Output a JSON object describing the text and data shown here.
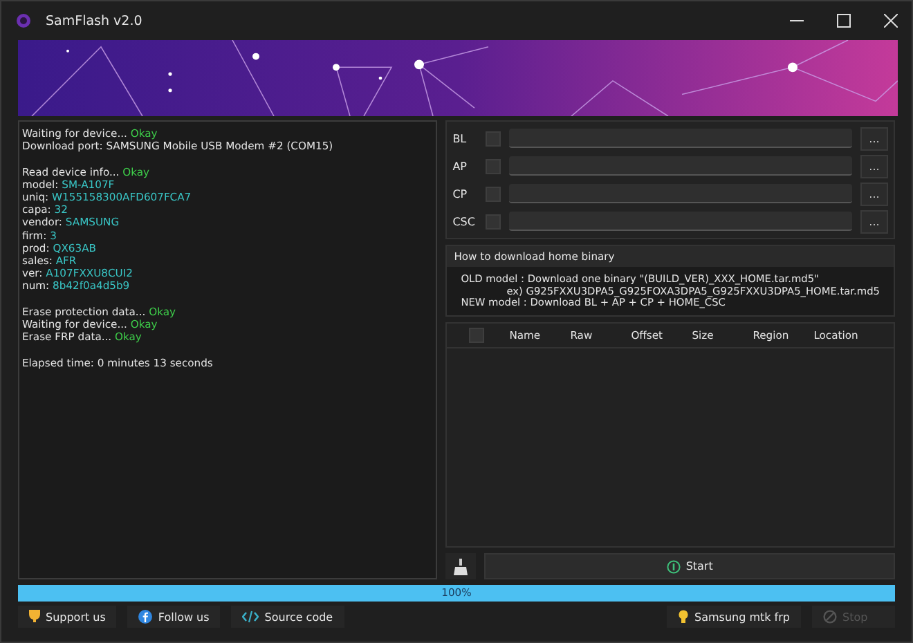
{
  "window": {
    "title": "SamFlash v2.0"
  },
  "log": [
    [
      {
        "parts": [
          {
            "text": "Waiting for device...",
            "kind": "plain"
          },
          {
            "text": "Okay",
            "kind": "ok"
          }
        ]
      },
      {
        "parts": [
          {
            "text": "Download port: SAMSUNG Mobile USB Modem #2 (COM15)",
            "kind": "plain"
          }
        ]
      }
    ],
    [
      {
        "parts": [
          {
            "text": "Read device info...",
            "kind": "plain"
          },
          {
            "text": "Okay",
            "kind": "ok"
          }
        ]
      },
      {
        "parts": [
          {
            "text": "model:",
            "kind": "plain"
          },
          {
            "text": "SM-A107F",
            "kind": "value"
          }
        ]
      },
      {
        "parts": [
          {
            "text": "uniq:",
            "kind": "plain"
          },
          {
            "text": "W155158300AFD607FCA7",
            "kind": "value"
          }
        ]
      },
      {
        "parts": [
          {
            "text": "capa:",
            "kind": "plain"
          },
          {
            "text": "32",
            "kind": "value"
          }
        ]
      },
      {
        "parts": [
          {
            "text": "vendor:",
            "kind": "plain"
          },
          {
            "text": "SAMSUNG",
            "kind": "value"
          }
        ]
      },
      {
        "parts": [
          {
            "text": "firm:",
            "kind": "plain"
          },
          {
            "text": "3",
            "kind": "value"
          }
        ]
      },
      {
        "parts": [
          {
            "text": "prod:",
            "kind": "plain"
          },
          {
            "text": "QX63AB",
            "kind": "value"
          }
        ]
      },
      {
        "parts": [
          {
            "text": "sales:",
            "kind": "plain"
          },
          {
            "text": "AFR",
            "kind": "value"
          }
        ]
      },
      {
        "parts": [
          {
            "text": "ver:",
            "kind": "plain"
          },
          {
            "text": "A107FXXU8CUI2",
            "kind": "value"
          }
        ]
      },
      {
        "parts": [
          {
            "text": "num:",
            "kind": "plain"
          },
          {
            "text": "8b42f0a4d5b9",
            "kind": "value"
          }
        ]
      }
    ],
    [
      {
        "parts": [
          {
            "text": "Erase protection data...",
            "kind": "plain"
          },
          {
            "text": "Okay",
            "kind": "ok"
          }
        ]
      },
      {
        "parts": [
          {
            "text": "Waiting for device...",
            "kind": "plain"
          },
          {
            "text": "Okay",
            "kind": "ok"
          }
        ]
      },
      {
        "parts": [
          {
            "text": "Erase FRP data...",
            "kind": "plain"
          },
          {
            "text": "Okay",
            "kind": "ok"
          }
        ]
      }
    ],
    [
      {
        "parts": [
          {
            "text": "Elapsed time: 0 minutes 13 seconds",
            "kind": "plain"
          }
        ]
      }
    ]
  ],
  "files": [
    {
      "label": "BL",
      "checked": false,
      "browse": "..."
    },
    {
      "label": "AP",
      "checked": false,
      "browse": "..."
    },
    {
      "label": "CP",
      "checked": false,
      "browse": "..."
    },
    {
      "label": "CSC",
      "checked": false,
      "browse": "..."
    }
  ],
  "info": {
    "title": "How to download home binary",
    "lines": [
      "OLD model  : Download one binary \"(BUILD_VER)_XXX_HOME.tar.md5\"",
      "ex) G925FXXU3DPA5_G925FOXA3DPA5_G925FXXU3DPA5_HOME.tar.md5",
      "NEW model : Download BL + AP + CP + HOME_CSC"
    ]
  },
  "table": {
    "select_all": {
      "checked": false
    },
    "columns": [
      "Name",
      "Raw",
      "Offset",
      "Size",
      "Region",
      "Location"
    ]
  },
  "start_button": "Start",
  "progress": {
    "level": 1,
    "label": "100%"
  },
  "footer_left": [
    {
      "kind": "support",
      "label": "Support us"
    },
    {
      "kind": "follow",
      "label": "Follow us"
    },
    {
      "kind": "source",
      "label": "Source code"
    }
  ],
  "footer_right": [
    {
      "kind": "tip",
      "label": "Samsung mtk frp",
      "disabled": false
    },
    {
      "kind": "stop",
      "label": "Stop",
      "disabled": true
    }
  ]
}
